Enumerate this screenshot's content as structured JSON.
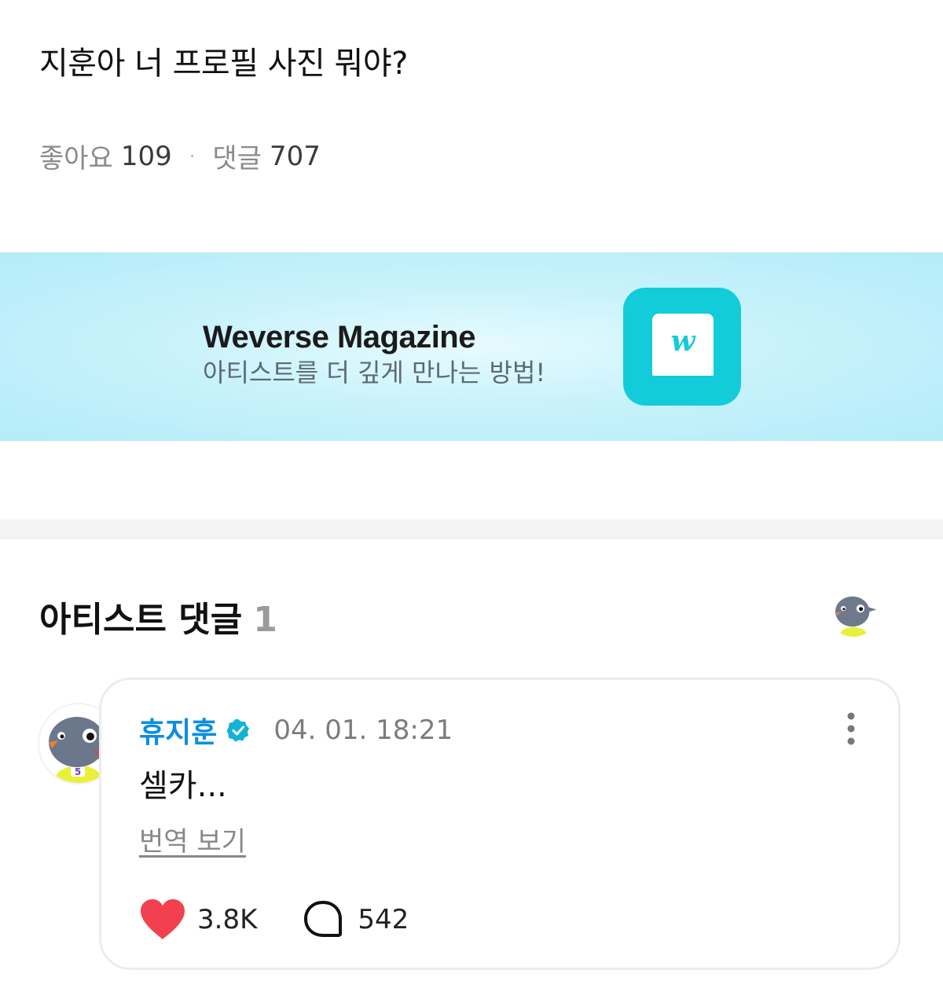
{
  "post": {
    "title": "지훈아 너 프로필 사진 뭐야?",
    "likes_label": "좋아요",
    "likes_count": "109",
    "separator": "·",
    "comments_label": "댓글",
    "comments_count": "707"
  },
  "banner": {
    "title": "Weverse Magazine",
    "subtitle": "아티스트를 더 깊게 만나는 방법!",
    "icon": "weverse-magazine-book-icon",
    "icon_letter": "w",
    "accent_color": "#12ccd9"
  },
  "artist_comments": {
    "title": "아티스트 댓글",
    "count": "1"
  },
  "comment": {
    "author": "휴지훈",
    "verified_icon": "verified-badge-icon",
    "timestamp": "04. 01. 18:21",
    "text": "셀카...",
    "translate_label": "번역 보기",
    "like_count": "3.8K",
    "reply_count": "542",
    "avatar_jersey_number": "5",
    "author_color": "#0a8fe0",
    "heart_color": "#f2404f"
  }
}
